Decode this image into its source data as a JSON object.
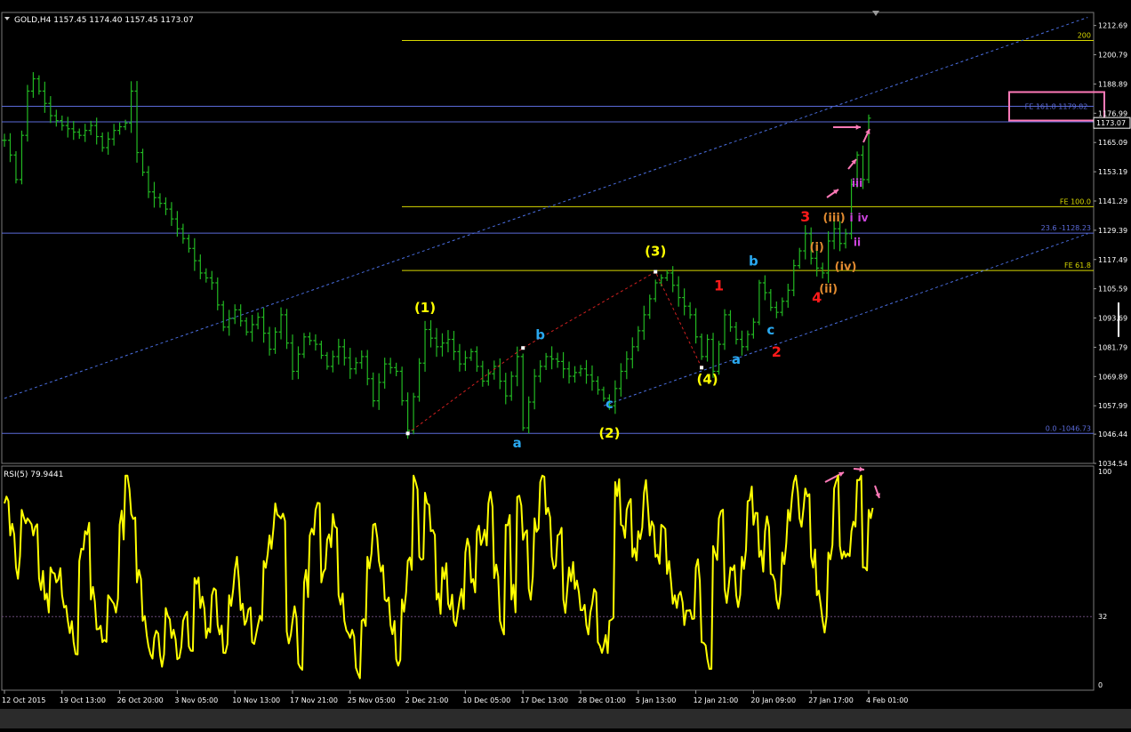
{
  "main_panel": {
    "header_text": "GOLD,H4  1157.45 1174.40 1157.45 1173.07"
  },
  "rsi_panel": {
    "header_text": "RSI(5) 79.9441"
  },
  "colors": {
    "background": "#000000",
    "price_bars": "#22b822",
    "rsi_line": "#ffff00",
    "grid_blue": "#5a6ad8",
    "fib_yellow": "#d8d800",
    "wave_yellow": "#ffff00",
    "wave_blue": "#29a8f0",
    "wave_red": "#ff1a1a",
    "wave_orange": "#e08a30",
    "wave_purple": "#cc44dd",
    "annotation_pink": "#ff7ab8"
  },
  "chart_data": [
    {
      "type": "ohlc",
      "symbol": "GOLD",
      "timeframe": "H4",
      "last_bar": {
        "open": 1157.45,
        "high": 1174.4,
        "low": 1157.45,
        "close": 1173.07
      },
      "ylim": [
        1034.54,
        1218.0
      ],
      "y_ticks": [
        1212.69,
        1200.79,
        1188.89,
        1176.99,
        1165.09,
        1153.19,
        1141.29,
        1129.39,
        1117.49,
        1105.59,
        1093.69,
        1081.79,
        1069.89,
        1057.99,
        1046.44,
        1034.54
      ],
      "price_label": "1173.07",
      "x_tick_labels": [
        "12 Oct 2015",
        "19 Oct 13:00",
        "26 Oct 20:00",
        "3 Nov 05:00",
        "10 Nov 13:00",
        "17 Nov 21:00",
        "25 Nov 05:00",
        "2 Dec 21:00",
        "10 Dec 05:00",
        "17 Dec 13:00",
        "28 Dec 01:00",
        "5 Jan 13:00",
        "12 Jan 21:00",
        "20 Jan 09:00",
        "27 Jan 17:00",
        "4 Feb 01:00"
      ],
      "x_tick_index": [
        0,
        10,
        20,
        30,
        40,
        50,
        60,
        70,
        80,
        90,
        100,
        110,
        120,
        130,
        140,
        150
      ],
      "anchors": [
        [
          0,
          1166
        ],
        [
          1,
          1160
        ],
        [
          2,
          1150
        ],
        [
          4,
          1186
        ],
        [
          5,
          1191
        ],
        [
          8,
          1176
        ],
        [
          10,
          1172
        ],
        [
          13,
          1168
        ],
        [
          15,
          1172
        ],
        [
          17,
          1163
        ],
        [
          19,
          1170
        ],
        [
          21,
          1173
        ],
        [
          22,
          1186
        ],
        [
          23,
          1161
        ],
        [
          25,
          1145
        ],
        [
          28,
          1138
        ],
        [
          30,
          1130
        ],
        [
          32,
          1122
        ],
        [
          34,
          1112
        ],
        [
          36,
          1108
        ],
        [
          38,
          1090
        ],
        [
          40,
          1097
        ],
        [
          42,
          1088
        ],
        [
          44,
          1094
        ],
        [
          46,
          1081
        ],
        [
          48,
          1095
        ],
        [
          50,
          1072
        ],
        [
          52,
          1086
        ],
        [
          54,
          1083
        ],
        [
          56,
          1074
        ],
        [
          58,
          1082
        ],
        [
          60,
          1073
        ],
        [
          62,
          1078
        ],
        [
          64,
          1060
        ],
        [
          66,
          1075
        ],
        [
          68,
          1072
        ],
        [
          70,
          1048
        ],
        [
          73,
          1089
        ],
        [
          75,
          1082
        ],
        [
          77,
          1085
        ],
        [
          79,
          1075
        ],
        [
          81,
          1080
        ],
        [
          83,
          1068
        ],
        [
          85,
          1074
        ],
        [
          87,
          1062
        ],
        [
          89,
          1078
        ],
        [
          90,
          1049
        ],
        [
          92,
          1070
        ],
        [
          94,
          1078
        ],
        [
          96,
          1076
        ],
        [
          98,
          1070
        ],
        [
          100,
          1073
        ],
        [
          102,
          1068
        ],
        [
          104,
          1061
        ],
        [
          105,
          1058
        ],
        [
          107,
          1072
        ],
        [
          109,
          1082
        ],
        [
          111,
          1095
        ],
        [
          113,
          1108
        ],
        [
          115,
          1112
        ],
        [
          117,
          1102
        ],
        [
          119,
          1095
        ],
        [
          120,
          1086
        ],
        [
          121,
          1078
        ],
        [
          122,
          1085
        ],
        [
          123,
          1072
        ],
        [
          124,
          1083
        ],
        [
          125,
          1095
        ],
        [
          127,
          1085
        ],
        [
          128,
          1082
        ],
        [
          130,
          1092
        ],
        [
          131,
          1108
        ],
        [
          132,
          1104
        ],
        [
          133,
          1098
        ],
        [
          134,
          1096
        ],
        [
          136,
          1105
        ],
        [
          137,
          1115
        ],
        [
          138,
          1121
        ],
        [
          139,
          1128
        ],
        [
          140,
          1118
        ],
        [
          141,
          1114
        ],
        [
          142,
          1112
        ],
        [
          143,
          1125
        ],
        [
          144,
          1130
        ],
        [
          145,
          1124
        ],
        [
          146,
          1128
        ],
        [
          147,
          1148
        ],
        [
          148,
          1160
        ],
        [
          149,
          1150
        ],
        [
          150,
          1175
        ]
      ],
      "horizontal_lines": [
        {
          "name": "fe-200",
          "price": 1206.6,
          "label": "200",
          "color": "#d8d800"
        },
        {
          "name": "fe-161-8",
          "price": 1179.82,
          "label": "FE 161.8 1179.82",
          "color": "#5a6ad8"
        },
        {
          "name": "level-1173",
          "price": 1173.5,
          "label": "",
          "color": "#5a6ad8"
        },
        {
          "name": "fe-100",
          "price": 1139.0,
          "label": "FE 100.0",
          "color": "#d8d800"
        },
        {
          "name": "fib-23-6",
          "price": 1128.23,
          "label": "23.6 -1128.23",
          "color": "#5a6ad8"
        },
        {
          "name": "fe-61-8",
          "price": 1113.0,
          "label": "FE 61.8",
          "color": "#d8d800"
        },
        {
          "name": "fib-0",
          "price": 1046.73,
          "label": "0.0 -1046.73",
          "color": "#5a6ad8"
        }
      ],
      "trend_channel_lines": [
        {
          "name": "upper-channel",
          "from": [
            0,
            1061
          ],
          "to": [
            188,
            1216
          ]
        },
        {
          "name": "lower-channel",
          "from": [
            104,
            1058
          ],
          "to": [
            188,
            1128
          ]
        }
      ],
      "wave_polyline": [
        [
          70,
          1046.73
        ],
        [
          90,
          1081.5
        ],
        [
          113,
          1112.5
        ],
        [
          121,
          1073.5
        ]
      ],
      "wave_labels": [
        {
          "text": "(1)",
          "i": 73,
          "price": 1096,
          "color": "#ffff00",
          "size": 15
        },
        {
          "text": "(2)",
          "i": 105,
          "price": 1045,
          "color": "#ffff00",
          "size": 15
        },
        {
          "text": "(3)",
          "i": 113,
          "price": 1119,
          "color": "#ffff00",
          "size": 15
        },
        {
          "text": "(4)",
          "i": 122,
          "price": 1067,
          "color": "#ffff00",
          "size": 15
        },
        {
          "text": "a",
          "i": 89,
          "price": 1041,
          "color": "#29a8f0",
          "size": 15
        },
        {
          "text": "b",
          "i": 93,
          "price": 1085,
          "color": "#29a8f0",
          "size": 15
        },
        {
          "text": "c",
          "i": 105,
          "price": 1057,
          "color": "#29a8f0",
          "size": 15
        },
        {
          "text": "a",
          "i": 127,
          "price": 1075,
          "color": "#29a8f0",
          "size": 15
        },
        {
          "text": "b",
          "i": 130,
          "price": 1115,
          "color": "#29a8f0",
          "size": 15
        },
        {
          "text": "c",
          "i": 133,
          "price": 1087,
          "color": "#29a8f0",
          "size": 15
        },
        {
          "text": "1",
          "i": 124,
          "price": 1105,
          "color": "#ff1a1a",
          "size": 16
        },
        {
          "text": "2",
          "i": 134,
          "price": 1078,
          "color": "#ff1a1a",
          "size": 16
        },
        {
          "text": "3",
          "i": 139,
          "price": 1133,
          "color": "#ff1a1a",
          "size": 16
        },
        {
          "text": "4",
          "i": 141,
          "price": 1100,
          "color": "#ff1a1a",
          "size": 16
        },
        {
          "text": "(i)",
          "i": 141,
          "price": 1121,
          "color": "#e08a30",
          "size": 13
        },
        {
          "text": "(ii)",
          "i": 143,
          "price": 1104,
          "color": "#e08a30",
          "size": 13
        },
        {
          "text": "(iii)",
          "i": 144,
          "price": 1133,
          "color": "#e08a30",
          "size": 13
        },
        {
          "text": "(iv)",
          "i": 146,
          "price": 1113,
          "color": "#e08a30",
          "size": 13
        },
        {
          "text": "i",
          "i": 147,
          "price": 1133,
          "color": "#cc44dd",
          "size": 12
        },
        {
          "text": "ii",
          "i": 148,
          "price": 1123,
          "color": "#cc44dd",
          "size": 12
        },
        {
          "text": "iii",
          "i": 148,
          "price": 1147,
          "color": "#cc44dd",
          "size": 12
        },
        {
          "text": "iv",
          "i": 149,
          "price": 1133,
          "color": "#cc44dd",
          "size": 12
        }
      ],
      "annotation_box": {
        "label": "FE 161.8 1179.82"
      }
    },
    {
      "type": "line",
      "name": "RSI(5)",
      "last_value": 79.9441,
      "ylim": [
        0,
        100
      ],
      "y_ticks": [
        100,
        32,
        0
      ],
      "level_line": 32,
      "anchors": [
        [
          0,
          85
        ],
        [
          1,
          70
        ],
        [
          2,
          55
        ],
        [
          3,
          82
        ],
        [
          4,
          78
        ],
        [
          5,
          70
        ],
        [
          6,
          50
        ],
        [
          7,
          40
        ],
        [
          8,
          55
        ],
        [
          9,
          48
        ],
        [
          10,
          42
        ],
        [
          11,
          30
        ],
        [
          12,
          20
        ],
        [
          13,
          58
        ],
        [
          14,
          72
        ],
        [
          15,
          40
        ],
        [
          16,
          26
        ],
        [
          17,
          20
        ],
        [
          18,
          42
        ],
        [
          19,
          38
        ],
        [
          20,
          75
        ],
        [
          21,
          98
        ],
        [
          22,
          80
        ],
        [
          23,
          48
        ],
        [
          24,
          30
        ],
        [
          25,
          18
        ],
        [
          26,
          22
        ],
        [
          27,
          14
        ],
        [
          28,
          36
        ],
        [
          29,
          22
        ],
        [
          30,
          12
        ],
        [
          31,
          30
        ],
        [
          32,
          18
        ],
        [
          33,
          50
        ],
        [
          34,
          36
        ],
        [
          35,
          22
        ],
        [
          36,
          42
        ],
        [
          37,
          28
        ],
        [
          38,
          15
        ],
        [
          39,
          42
        ],
        [
          40,
          54
        ],
        [
          41,
          35
        ],
        [
          42,
          30
        ],
        [
          43,
          20
        ],
        [
          44,
          28
        ],
        [
          45,
          58
        ],
        [
          46,
          70
        ],
        [
          47,
          85
        ],
        [
          48,
          78
        ],
        [
          49,
          25
        ],
        [
          50,
          30
        ],
        [
          51,
          10
        ],
        [
          52,
          48
        ],
        [
          53,
          70
        ],
        [
          54,
          82
        ],
        [
          55,
          48
        ],
        [
          56,
          68
        ],
        [
          57,
          80
        ],
        [
          58,
          42
        ],
        [
          59,
          30
        ],
        [
          60,
          22
        ],
        [
          61,
          8
        ],
        [
          62,
          30
        ],
        [
          63,
          60
        ],
        [
          64,
          75
        ],
        [
          65,
          58
        ],
        [
          66,
          40
        ],
        [
          67,
          28
        ],
        [
          68,
          12
        ],
        [
          69,
          40
        ],
        [
          70,
          58
        ],
        [
          71,
          98
        ],
        [
          72,
          60
        ],
        [
          73,
          90
        ],
        [
          74,
          72
        ],
        [
          75,
          40
        ],
        [
          76,
          55
        ],
        [
          77,
          38
        ],
        [
          78,
          30
        ],
        [
          79,
          40
        ],
        [
          80,
          62
        ],
        [
          81,
          48
        ],
        [
          82,
          72
        ],
        [
          83,
          68
        ],
        [
          84,
          85
        ],
        [
          85,
          50
        ],
        [
          86,
          30
        ],
        [
          87,
          75
        ],
        [
          88,
          40
        ],
        [
          89,
          88
        ],
        [
          90,
          68
        ],
        [
          91,
          45
        ],
        [
          92,
          78
        ],
        [
          93,
          95
        ],
        [
          94,
          80
        ],
        [
          95,
          60
        ],
        [
          96,
          70
        ],
        [
          97,
          40
        ],
        [
          98,
          55
        ],
        [
          99,
          45
        ],
        [
          100,
          35
        ],
        [
          101,
          28
        ],
        [
          102,
          38
        ],
        [
          103,
          20
        ],
        [
          104,
          18
        ],
        [
          105,
          30
        ],
        [
          106,
          95
        ],
        [
          107,
          75
        ],
        [
          108,
          82
        ],
        [
          109,
          60
        ],
        [
          110,
          72
        ],
        [
          111,
          90
        ],
        [
          112,
          70
        ],
        [
          113,
          60
        ],
        [
          114,
          75
        ],
        [
          115,
          52
        ],
        [
          116,
          38
        ],
        [
          117,
          42
        ],
        [
          118,
          28
        ],
        [
          119,
          35
        ],
        [
          120,
          55
        ],
        [
          121,
          20
        ],
        [
          122,
          12
        ],
        [
          123,
          65
        ],
        [
          124,
          78
        ],
        [
          125,
          45
        ],
        [
          126,
          55
        ],
        [
          127,
          42
        ],
        [
          128,
          60
        ],
        [
          129,
          86
        ],
        [
          130,
          75
        ],
        [
          131,
          60
        ],
        [
          132,
          72
        ],
        [
          133,
          52
        ],
        [
          134,
          40
        ],
        [
          135,
          62
        ],
        [
          136,
          82
        ],
        [
          137,
          95
        ],
        [
          138,
          78
        ],
        [
          139,
          92
        ],
        [
          140,
          60
        ],
        [
          141,
          42
        ],
        [
          142,
          30
        ],
        [
          143,
          62
        ],
        [
          144,
          92
        ],
        [
          145,
          65
        ],
        [
          146,
          60
        ],
        [
          147,
          72
        ],
        [
          148,
          96
        ],
        [
          149,
          55
        ],
        [
          150,
          82
        ]
      ]
    }
  ]
}
